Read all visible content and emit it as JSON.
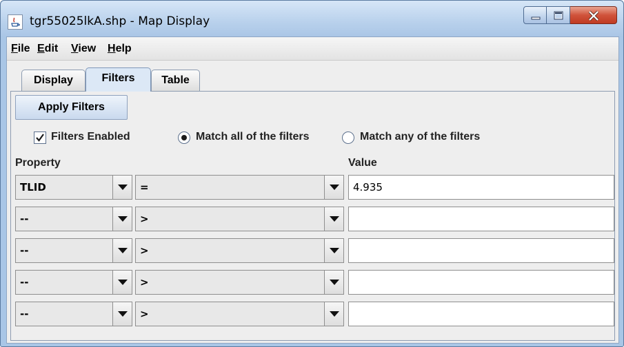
{
  "window": {
    "title": "tgr55025lkA.shp - Map Display"
  },
  "menubar": {
    "items": [
      {
        "mnemonic": "F",
        "rest": "ile"
      },
      {
        "mnemonic": "E",
        "rest": "dit"
      },
      {
        "mnemonic": "V",
        "rest": "iew"
      },
      {
        "mnemonic": "H",
        "rest": "elp"
      }
    ]
  },
  "tabs": {
    "display": "Display",
    "filters": "Filters",
    "table": "Table",
    "active": "Filters"
  },
  "filters": {
    "apply_label": "Apply Filters",
    "enabled_label": "Filters Enabled",
    "enabled_checked": true,
    "match_all_label": "Match all of the filters",
    "match_any_label": "Match any of the filters",
    "match_mode": "all",
    "property_header": "Property",
    "value_header": "Value",
    "rows": [
      {
        "property": "TLID",
        "operator": "=",
        "value": "4.935"
      },
      {
        "property": "--",
        "operator": ">",
        "value": ""
      },
      {
        "property": "--",
        "operator": ">",
        "value": ""
      },
      {
        "property": "--",
        "operator": ">",
        "value": ""
      },
      {
        "property": "--",
        "operator": ">",
        "value": ""
      }
    ]
  }
}
